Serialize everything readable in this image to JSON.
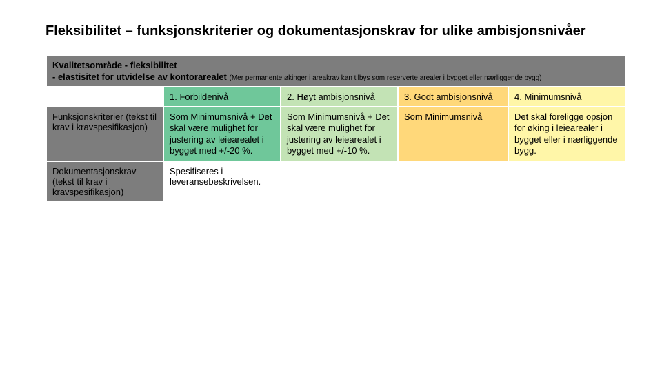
{
  "title": "Fleksibilitet – funksjonskriterier og dokumentasjonskrav for ulike ambisjonsnivåer",
  "header": {
    "line1": "Kvalitetsområde - fleksibilitet",
    "line2_bold": "- elastisitet for utvidelse av kontorarealet",
    "line2_note": "(Mer permanente økinger i areakrav kan tilbys som reserverte arealer i bygget eller nærliggende bygg)"
  },
  "levels": {
    "l1": "1. Forbildenivå",
    "l2": "2. Høyt ambisjonsnivå",
    "l3": "3. Godt ambisjonsnivå",
    "l4": "4. Minimumsnivå"
  },
  "rows": {
    "funk_label": "Funksjonskriterier (tekst til krav i kravspesifikasjon)",
    "dok_label": "Dokumentasjonskrav (tekst til krav i kravspesifikasjon)"
  },
  "cells": {
    "funk": {
      "c1": "Som Minimumsnivå +\nDet skal være mulighet for justering av leiearealet i bygget med +/-20 %.",
      "c2": "Som Minimumsnivå +\nDet skal være mulighet for justering av leiearealet i bygget med +/-10 %.",
      "c3": "Som Minimumsnivå",
      "c4": "Det skal foreligge opsjon for øking i leiearealer i bygget eller i nærliggende bygg."
    },
    "dok": {
      "c1": "Spesifiseres i leveransebeskrivelsen."
    }
  }
}
